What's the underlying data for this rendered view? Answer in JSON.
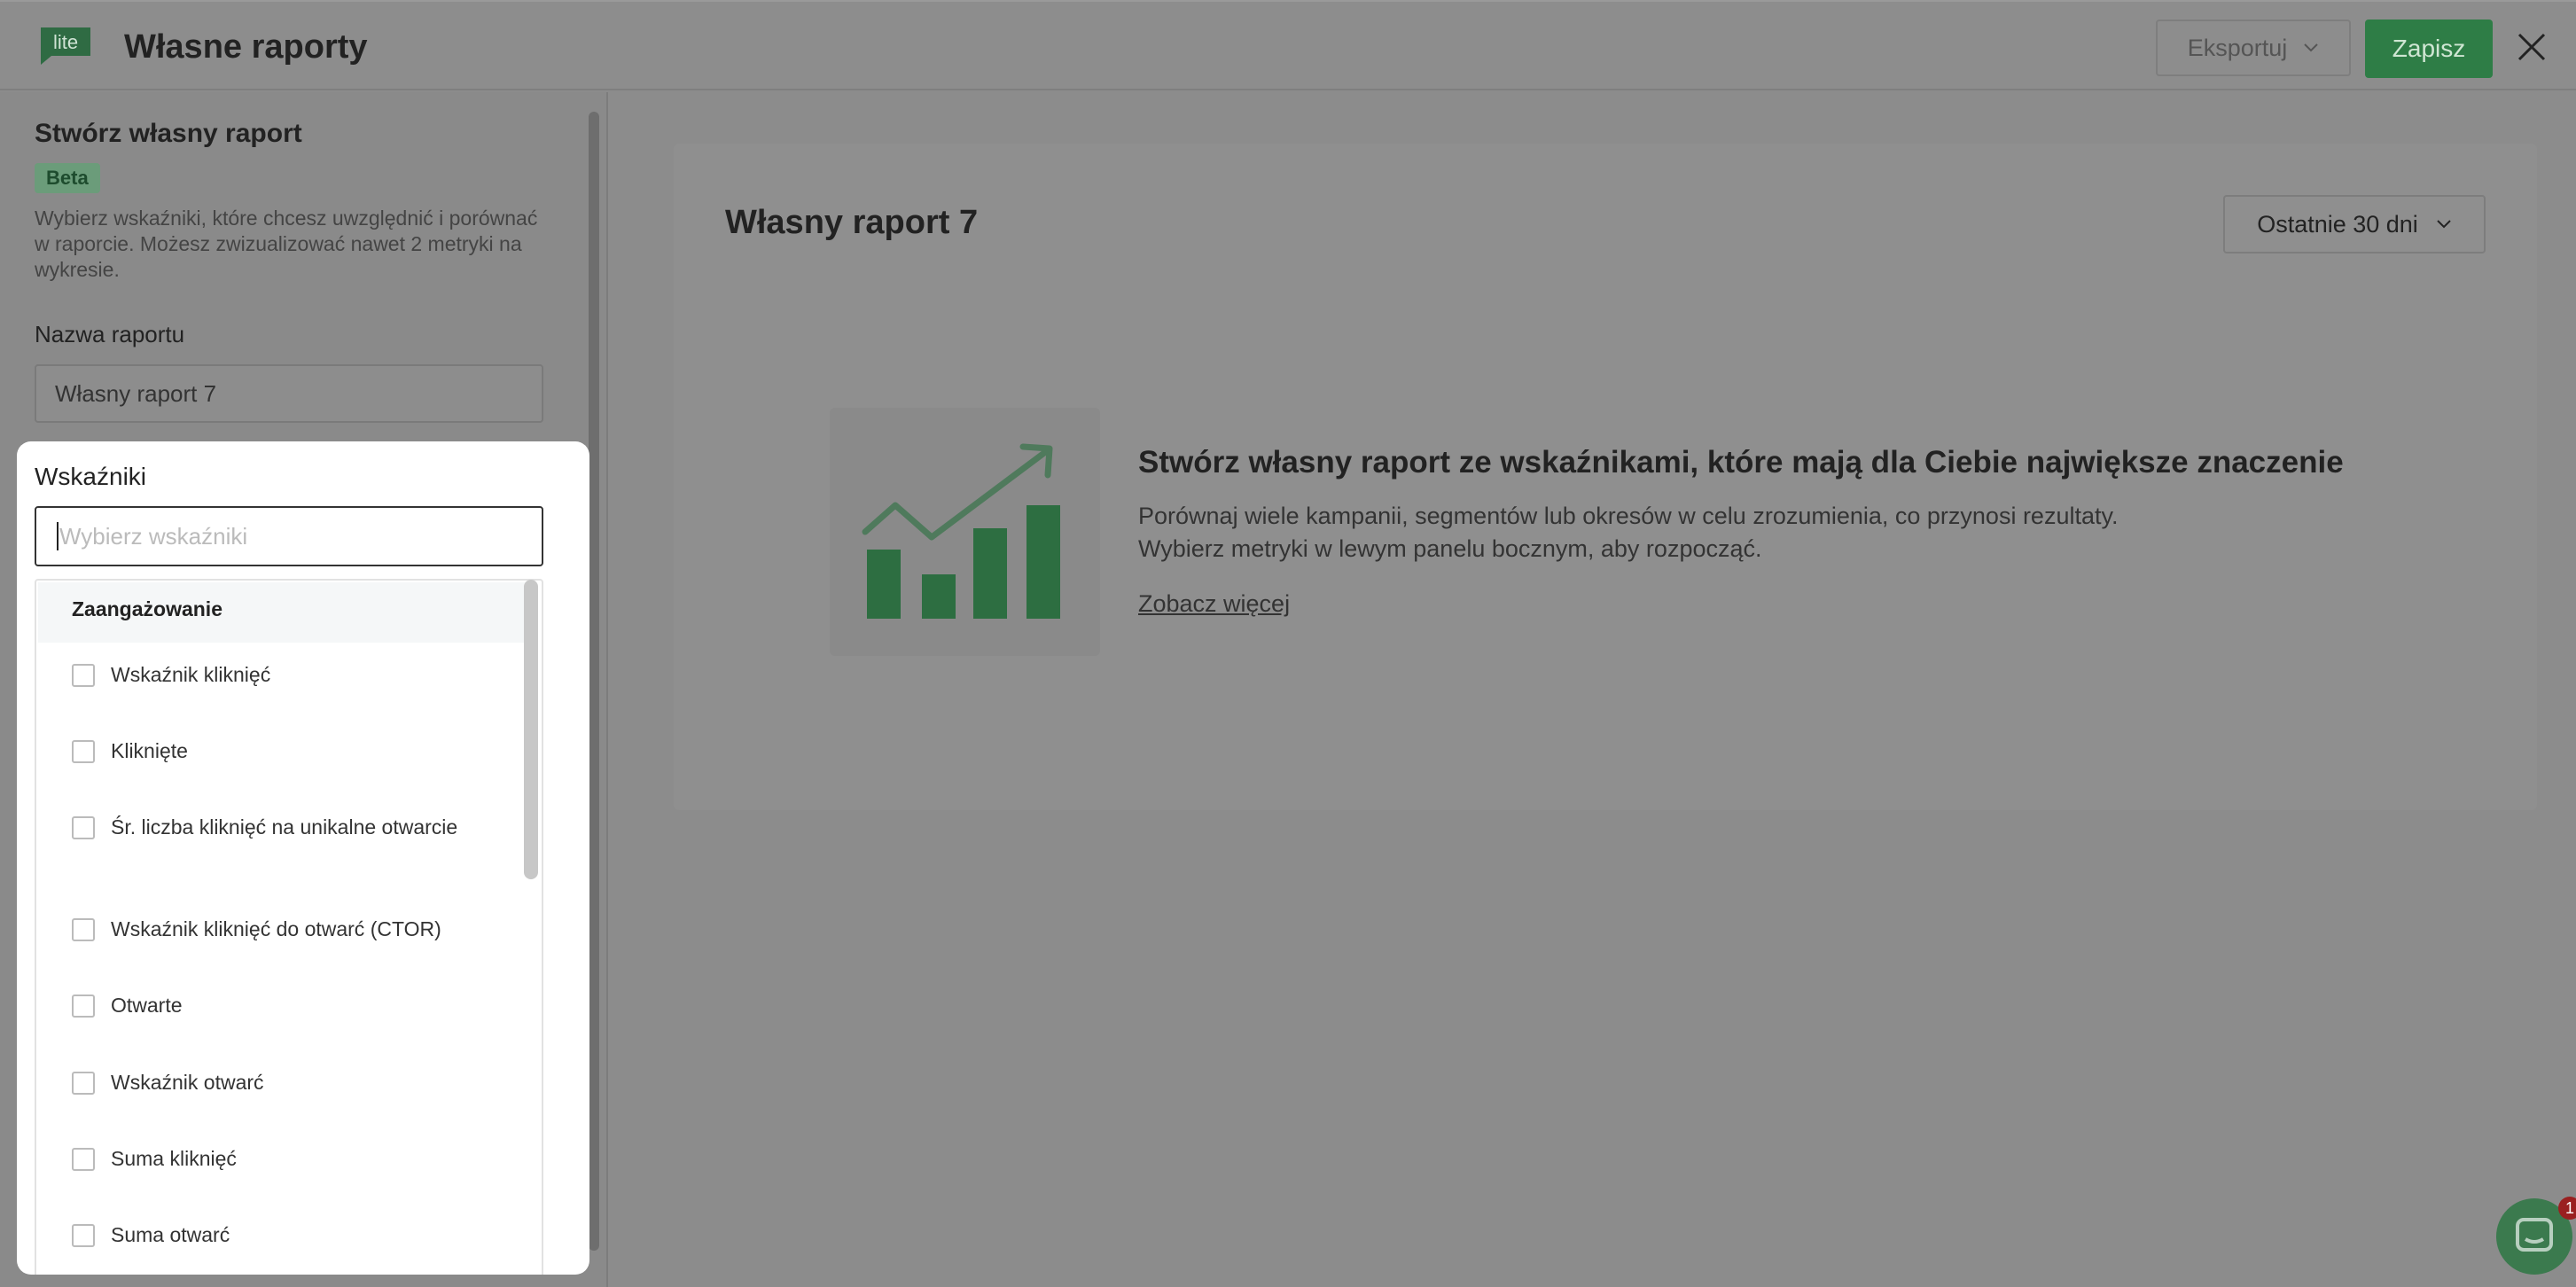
{
  "header": {
    "logo_text": "lite",
    "title": "Własne raporty",
    "export_label": "Eksportuj",
    "save_label": "Zapisz"
  },
  "sidebar": {
    "title": "Stwórz własny raport",
    "badge": "Beta",
    "description": "Wybierz wskaźniki, które chcesz uwzględnić i porównać w raporcie. Możesz zwizualizować nawet 2 metryki na wykresie.",
    "name_label": "Nazwa raportu",
    "name_value": "Własny raport 7"
  },
  "metrics": {
    "label": "Wskaźniki",
    "placeholder": "Wybierz wskaźniki",
    "group": "Zaangażowanie",
    "options": [
      {
        "label": "Wskaźnik kliknięć",
        "checked": false
      },
      {
        "label": "Kliknięte",
        "checked": false
      },
      {
        "label": "Śr. liczba kliknięć na unikalne otwarcie",
        "checked": false
      },
      {
        "label": "Wskaźnik kliknięć do otwarć (CTOR)",
        "checked": false
      },
      {
        "label": "Otwarte",
        "checked": false
      },
      {
        "label": "Wskaźnik otwarć",
        "checked": false
      },
      {
        "label": "Suma kliknięć",
        "checked": false
      },
      {
        "label": "Suma otwarć",
        "checked": false
      }
    ]
  },
  "main": {
    "report_title": "Własny raport 7",
    "date_range": "Ostatnie 30 dni",
    "empty_heading": "Stwórz własny raport ze wskaźnikami, które mają dla Ciebie największe znaczenie",
    "empty_line1": "Porównaj wiele kampanii, segmentów lub okresów w celu zrozumienia, co przynosi rezultaty.",
    "empty_line2": "Wybierz metryki w lewym panelu bocznym, aby rozpocząć.",
    "more_link": "Zobacz więcej"
  },
  "chat": {
    "badge_count": "1"
  },
  "colors": {
    "accent": "#2e7d46",
    "overlay": "#8c8c8c"
  }
}
